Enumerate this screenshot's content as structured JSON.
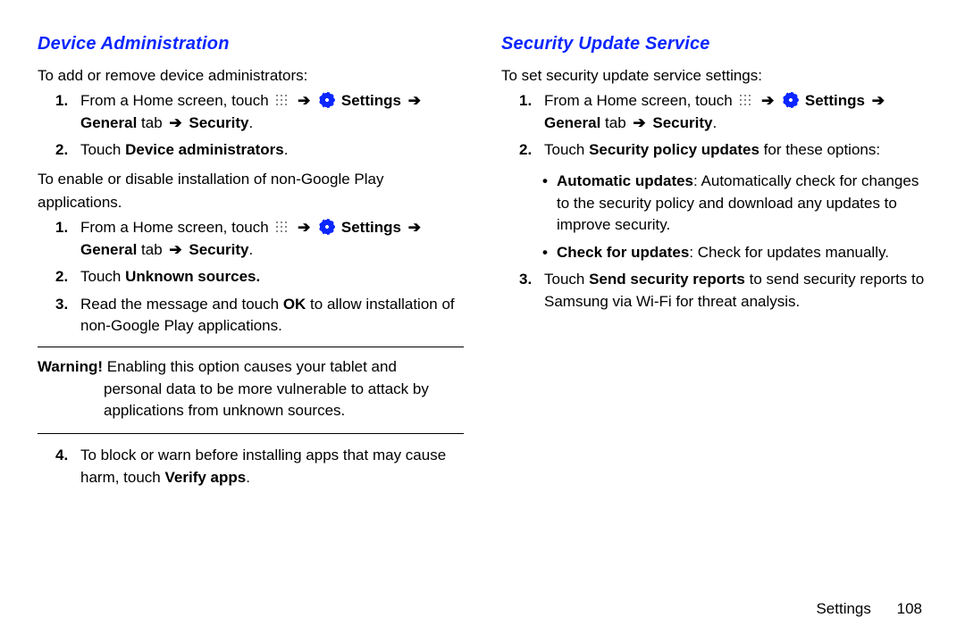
{
  "left": {
    "heading": "Device Administration",
    "intro1": "To add or remove device administrators:",
    "s1_pre": "From a Home screen, touch",
    "settings_word": "Settings",
    "s1_suffix_line2_a": "General",
    "s1_suffix_line2_b": " tab ",
    "s1_suffix_line2_c": "Security",
    "s2_a": "Touch ",
    "s2_b": "Device administrators",
    "intro2a": "To enable or disable installation of non-Google Play",
    "intro2b": "applications.",
    "s3_a": "Touch ",
    "s3_b": "Unknown sources.",
    "s4_a": "Read the message and touch ",
    "s4_b": "OK",
    "s4_c": " to allow installation of non-Google Play applications.",
    "warn_label": "Warning!",
    "warn_line1": " Enabling this option causes your tablet and",
    "warn_rest": "personal data to be more vulnerable to attack by applications from unknown sources.",
    "s5_a": "To block or warn before installing apps that may cause harm, touch ",
    "s5_b": "Verify apps"
  },
  "right": {
    "heading": "Security Update Service",
    "intro1": "To set security update service settings:",
    "s2_a": "Touch ",
    "s2_b": "Security policy updates",
    "s2_c": " for these options:",
    "b1_a": "Automatic updates",
    "b1_b": ": Automatically check for changes to the security policy and download any updates to improve security.",
    "b2_a": "Check for updates",
    "b2_b": ": Check for updates manually.",
    "s3_a": "Touch ",
    "s3_b": "Send security reports",
    "s3_c": " to send security reports to Samsung via Wi-Fi for threat analysis."
  },
  "arrow": "➔",
  "period": ".",
  "footer": {
    "chapter": "Settings",
    "page": "108"
  },
  "nums": {
    "n1": "1.",
    "n2": "2.",
    "n3": "3.",
    "n4": "4."
  }
}
